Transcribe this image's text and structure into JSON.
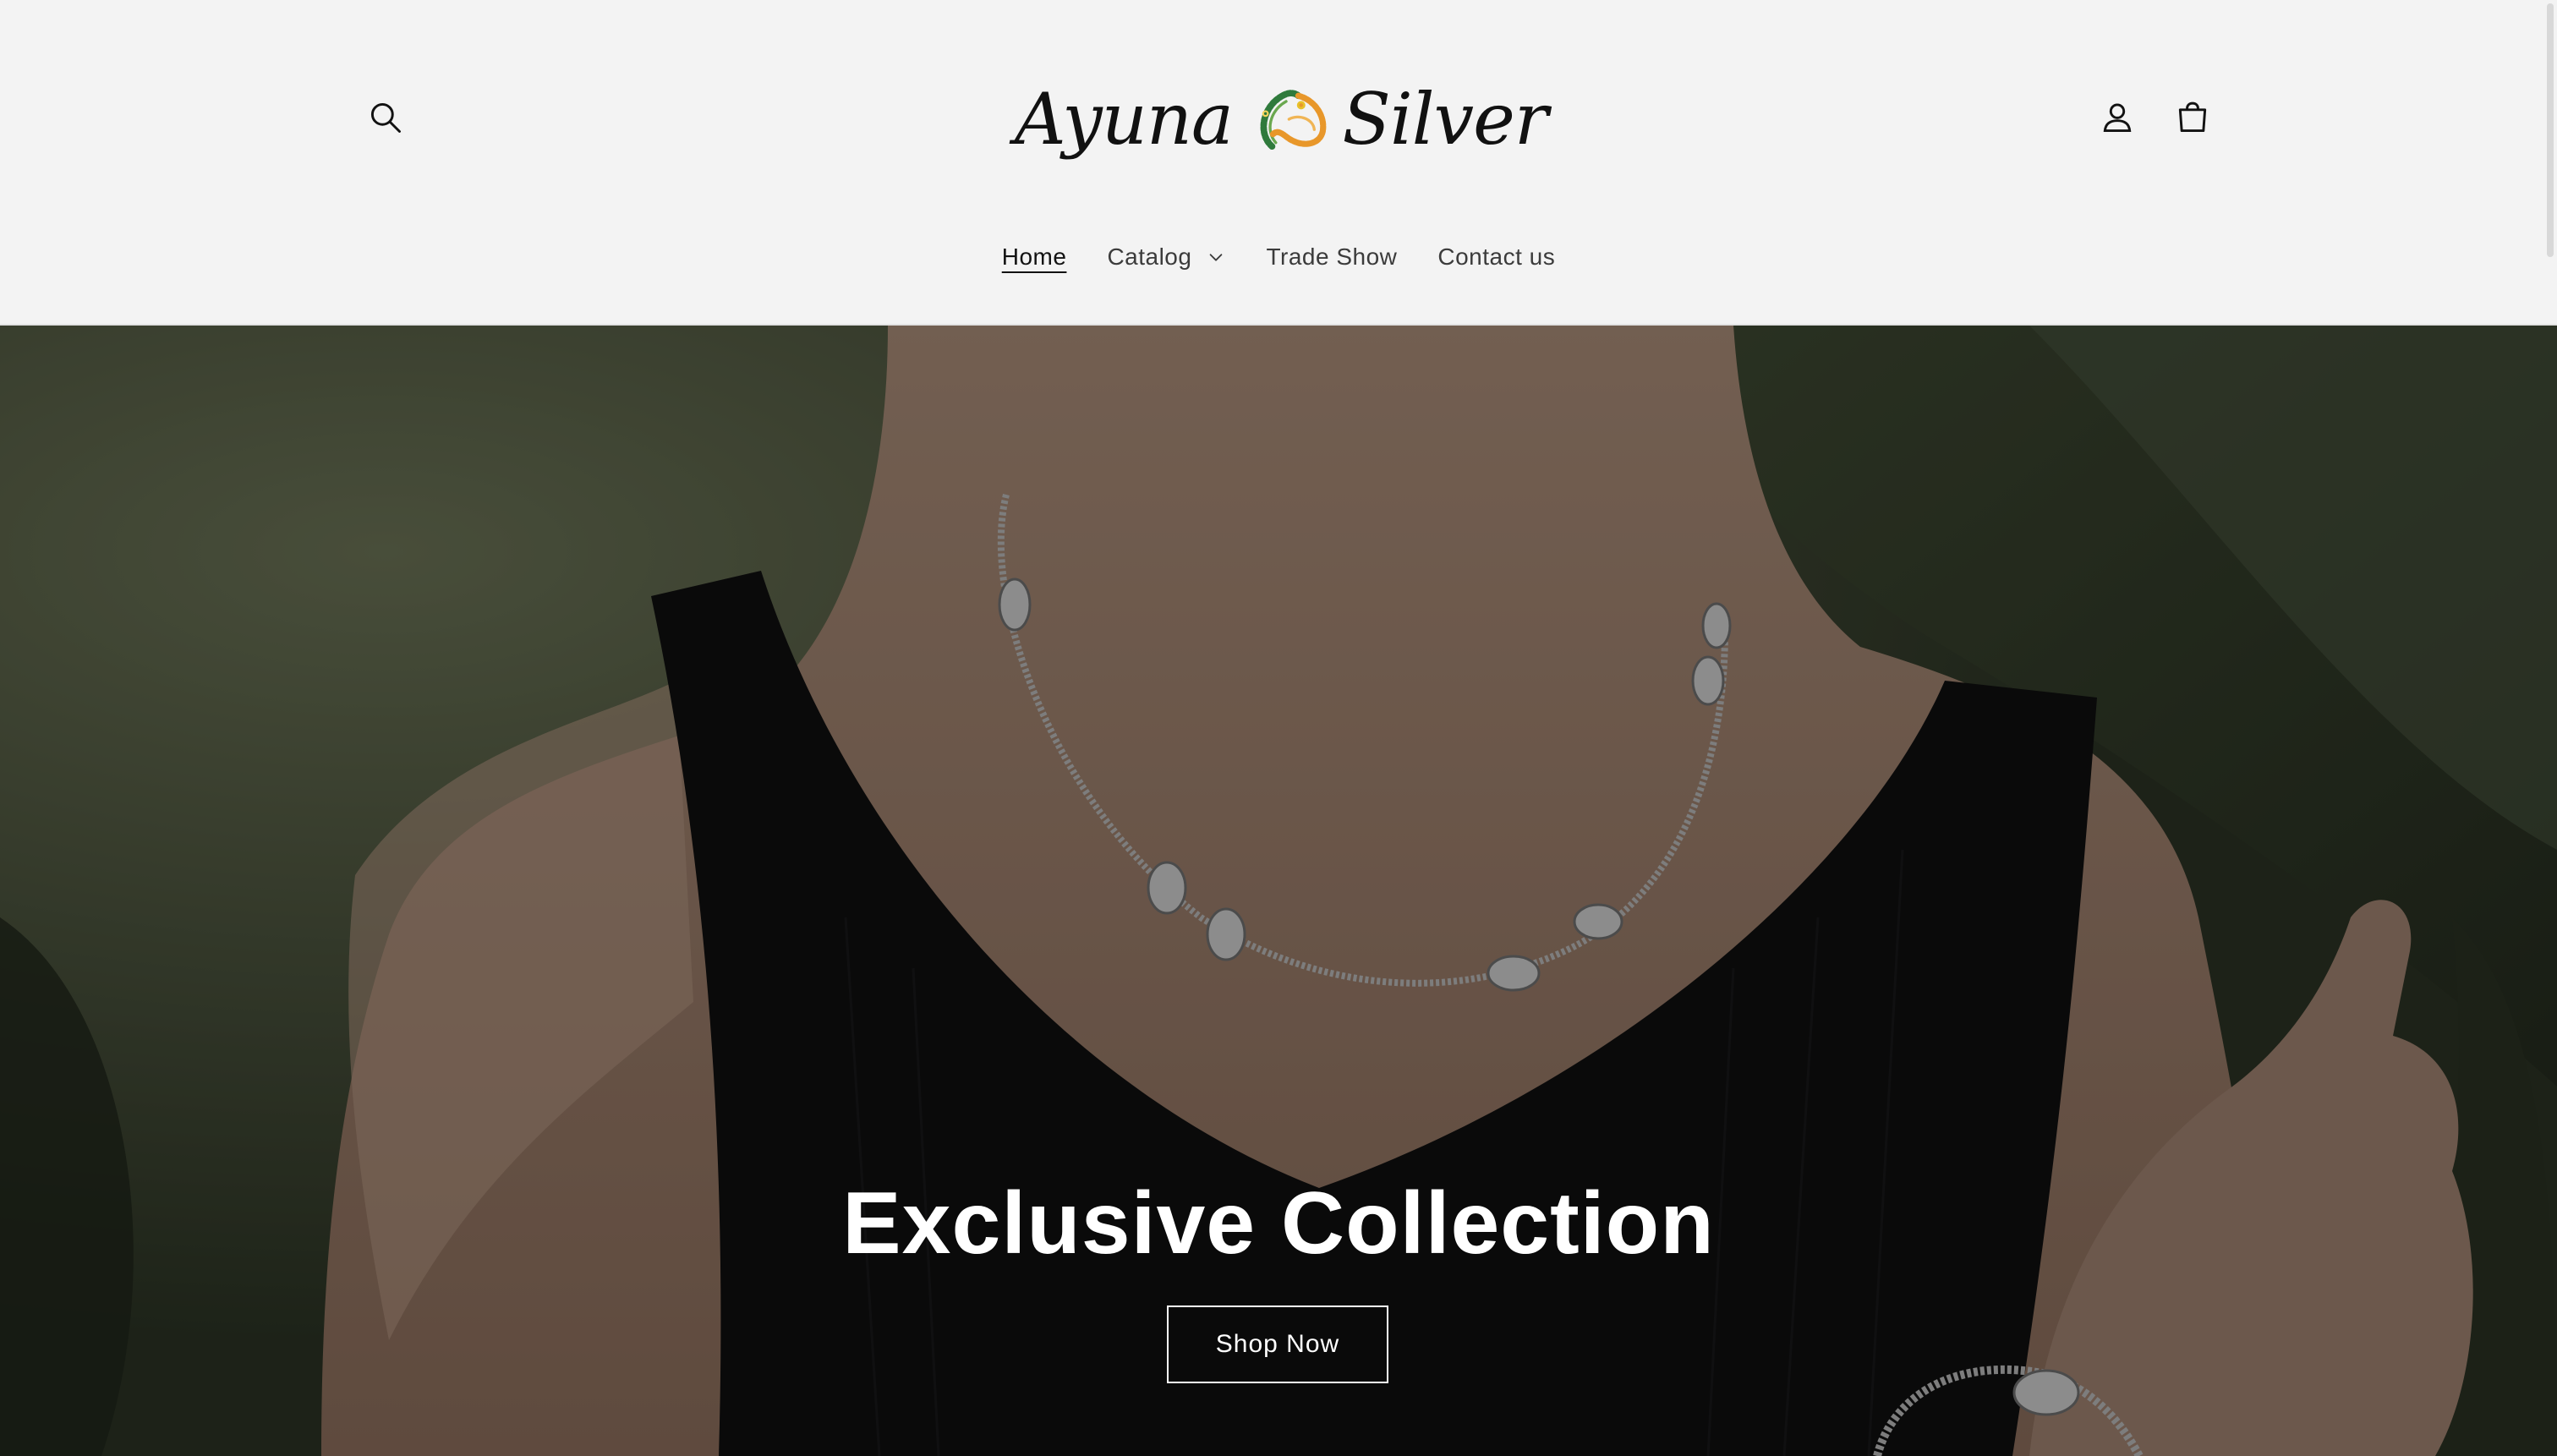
{
  "header": {
    "logo": {
      "word_left": "Ayuna",
      "word_right": "Silver"
    },
    "icons": {
      "search": "search-icon",
      "account": "account-icon",
      "cart": "cart-icon"
    }
  },
  "nav": {
    "items": [
      {
        "label": "Home",
        "active": true
      },
      {
        "label": "Catalog",
        "has_dropdown": true
      },
      {
        "label": "Trade Show"
      },
      {
        "label": "Contact us"
      }
    ]
  },
  "hero": {
    "title": "Exclusive Collection",
    "button_label": "Shop Now"
  },
  "colors": {
    "header_bg": "#f3f3f3",
    "text": "#121212",
    "hero_text": "#ffffff",
    "emblem_green": "#2f7a3c",
    "emblem_orange": "#e8972a"
  }
}
